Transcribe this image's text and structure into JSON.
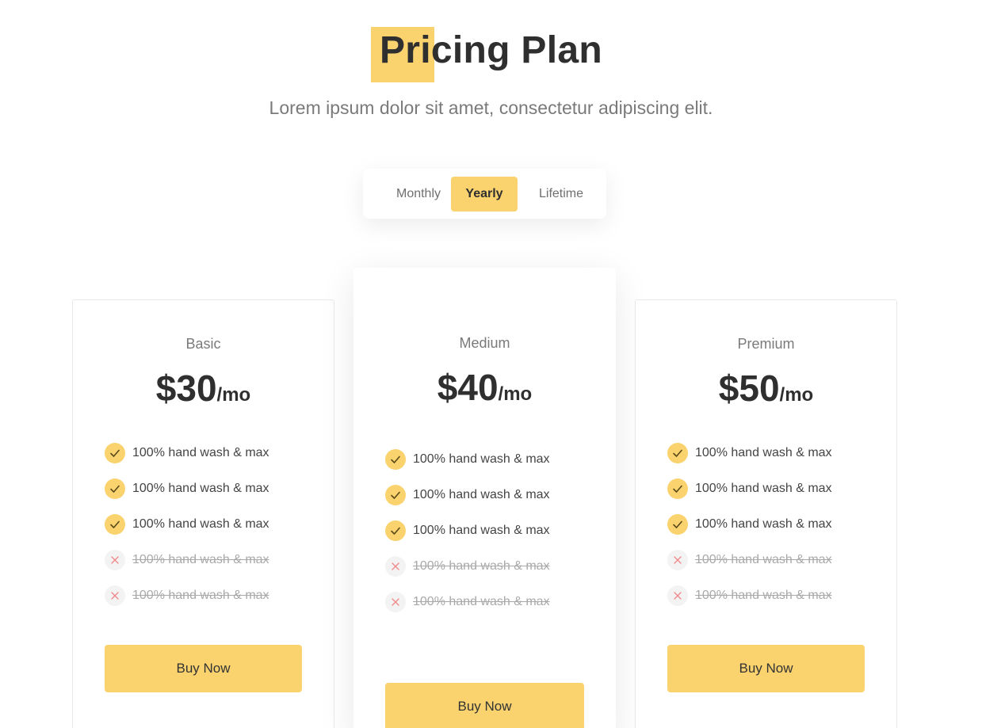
{
  "header": {
    "title": "Pricing Plan",
    "subtitle": "Lorem ipsum dolor sit amet, consectetur adipiscing elit."
  },
  "billing_toggle": {
    "options": [
      "Monthly",
      "Yearly",
      "Lifetime"
    ],
    "selected": "Yearly"
  },
  "colors": {
    "accent": "#fad36f",
    "heading": "#2f2f2f",
    "muted": "#7a7a7a"
  },
  "plans": [
    {
      "name": "Basic",
      "price": "$30",
      "period": "/mo",
      "features": [
        {
          "text": "100% hand wash & max",
          "included": true
        },
        {
          "text": "100% hand wash & max",
          "included": true
        },
        {
          "text": "100% hand wash & max",
          "included": true
        },
        {
          "text": "100% hand wash & max",
          "included": false
        },
        {
          "text": "100% hand wash & max",
          "included": false
        }
      ],
      "cta": "Buy Now"
    },
    {
      "name": "Medium",
      "price": "$40",
      "period": "/mo",
      "features": [
        {
          "text": "100% hand wash & max",
          "included": true
        },
        {
          "text": "100% hand wash & max",
          "included": true
        },
        {
          "text": "100% hand wash & max",
          "included": true
        },
        {
          "text": "100% hand wash & max",
          "included": false
        },
        {
          "text": "100% hand wash & max",
          "included": false
        }
      ],
      "cta": "Buy Now"
    },
    {
      "name": "Premium",
      "price": "$50",
      "period": "/mo",
      "features": [
        {
          "text": "100% hand wash & max",
          "included": true
        },
        {
          "text": "100% hand wash & max",
          "included": true
        },
        {
          "text": "100% hand wash & max",
          "included": true
        },
        {
          "text": "100% hand wash & max",
          "included": false
        },
        {
          "text": "100% hand wash & max",
          "included": false
        }
      ],
      "cta": "Buy Now"
    }
  ],
  "icons": {
    "included": "check-icon",
    "excluded": "close-icon"
  }
}
